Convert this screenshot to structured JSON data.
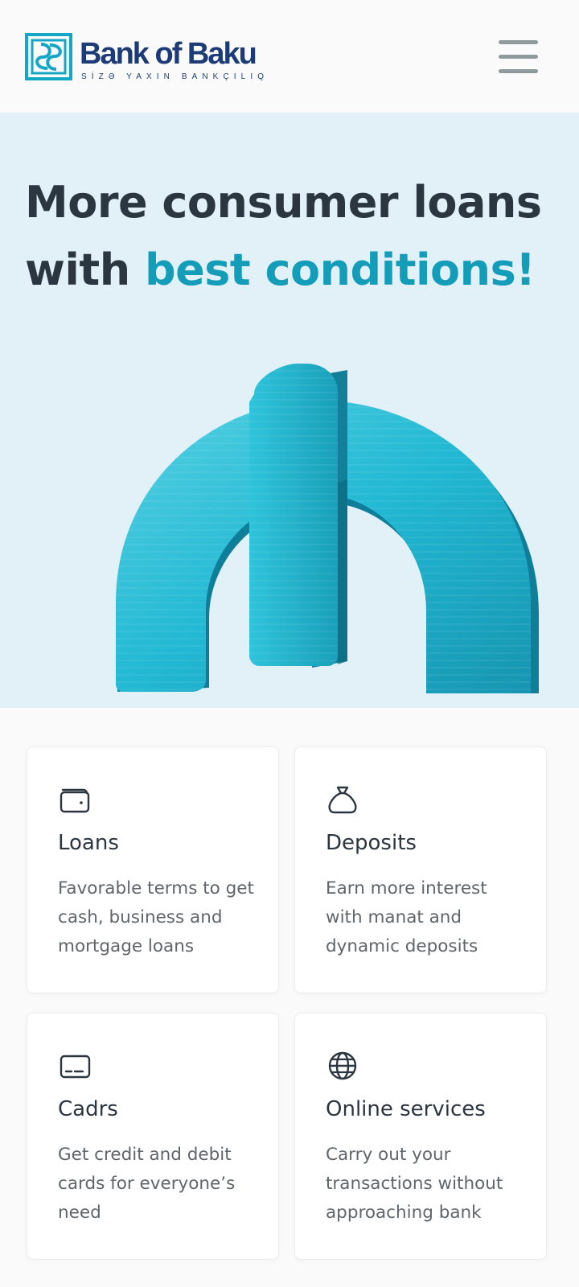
{
  "header": {
    "logo_name": "Bank of Baku",
    "logo_tagline": "SİZƏ YAXIN BANKÇILIQ",
    "menu_icon": "hamburger-menu-icon",
    "brand_color": "#1d3b77",
    "logo_color": "#13a6c6"
  },
  "hero": {
    "title_line1": "More consumer loans",
    "title_line2_prefix": "with ",
    "title_line2_accent": "best conditions!",
    "image": "3d-manat-symbol",
    "accent_color": "#139db9",
    "background": "#e2f1f7"
  },
  "cards": [
    {
      "icon": "wallet-icon",
      "title": "Loans",
      "description": "Favorable terms to get cash, business and mortgage loans"
    },
    {
      "icon": "money-bag-icon",
      "title": "Deposits",
      "description": "Earn more interest with manat and dynamic deposits"
    },
    {
      "icon": "card-icon",
      "title": "Cadrs",
      "description": "Get credit and debit cards for everyone’s need"
    },
    {
      "icon": "globe-icon",
      "title": "Online services",
      "description": "Carry out your transactions without approaching bank"
    }
  ]
}
